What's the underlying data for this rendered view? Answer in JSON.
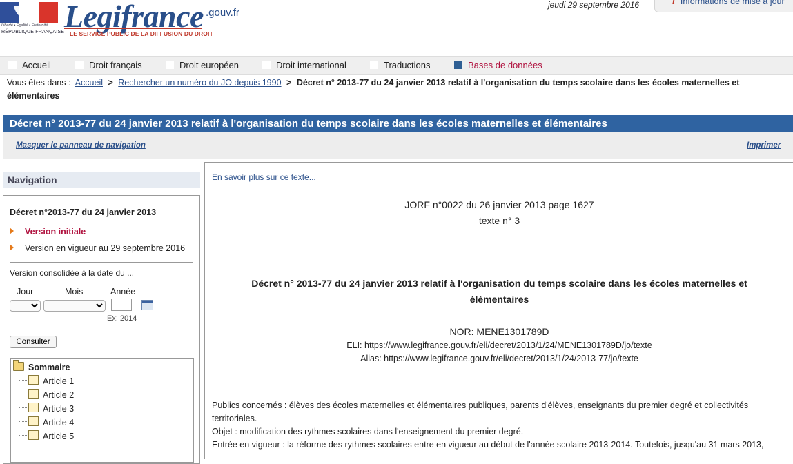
{
  "header": {
    "logo_motto": "Liberté • Égalité • Fraternité",
    "logo_republic": "RÉPUBLIQUE FRANÇAISE",
    "logo_word": "Legifrance",
    "logo_suffix": ".gouv.fr",
    "logo_tagline": "LE SERVICE PUBLIC DE LA DIFFUSION DU DROIT",
    "date": "jeudi 29 septembre 2016",
    "info_icon": "i",
    "info_label": "Informations de mise à jour"
  },
  "menu": {
    "items": [
      {
        "label": "Accueil"
      },
      {
        "label": "Droit français"
      },
      {
        "label": "Droit européen"
      },
      {
        "label": "Droit international"
      },
      {
        "label": "Traductions"
      },
      {
        "label": "Bases de données"
      }
    ],
    "active": "Bases de données"
  },
  "breadcrumb": {
    "prefix": "Vous êtes dans :",
    "links": [
      "Accueil",
      "Rechercher un numéro du JO depuis 1990"
    ],
    "separator": ">",
    "current": "Décret n° 2013-77 du 24 janvier 2013 relatif à l'organisation du temps scolaire dans les écoles maternelles et élémentaires"
  },
  "title": "Décret n° 2013-77 du 24 janvier 2013 relatif à l'organisation du temps scolaire dans les écoles maternelles et élémentaires",
  "toolbar": {
    "hide_nav": "Masquer le panneau de navigation",
    "print": "Imprimer"
  },
  "nav": {
    "heading": "Navigation",
    "doc_title": "Décret n°2013-77 du 24 janvier 2013",
    "version_initial": "Version initiale",
    "version_current": "Version en vigueur au 29 septembre 2016",
    "consolidated_label": "Version consolidée à la date du ...",
    "day_label": "Jour",
    "month_label": "Mois",
    "year_label": "Année",
    "year_example": "Ex: 2014",
    "submit": "Consulter",
    "tree": {
      "root": "Sommaire",
      "items": [
        "Article 1",
        "Article 2",
        "Article 3",
        "Article 4",
        "Article 5"
      ]
    }
  },
  "content": {
    "more_link": "En savoir plus sur ce texte...",
    "jorf": "JORF n°0022 du 26 janvier 2013 page 1627",
    "texte": "texte n° 3",
    "heading_line1": "Décret n° 2013-77 du 24 janvier 2013 relatif à l'organisation du temps scolaire dans les écoles maternelles et",
    "heading_line2": "élémentaires",
    "nor": "NOR: MENE1301789D",
    "eli": "ELI: https://www.legifrance.gouv.fr/eli/decret/2013/1/24/MENE1301789D/jo/texte",
    "alias": "Alias: https://www.legifrance.gouv.fr/eli/decret/2013/1/24/2013-77/jo/texte",
    "para1_line1": "Publics concernés : élèves des écoles maternelles et élémentaires publiques, parents d'élèves, enseignants du premier degré et collectivités",
    "para1_line2": "territoriales.",
    "para2": "Objet : modification des rythmes scolaires dans l'enseignement du premier degré.",
    "para3": "Entrée en vigueur : la réforme des rythmes scolaires entre en vigueur au début de l'année scolaire 2013-2014. Toutefois, jusqu'au 31 mars 2013,"
  },
  "colors": {
    "title_bar": "#2f63a1",
    "link_blue": "#2a4f8a",
    "active_red": "#b0123f",
    "arrow_orange": "#e57a1b"
  }
}
